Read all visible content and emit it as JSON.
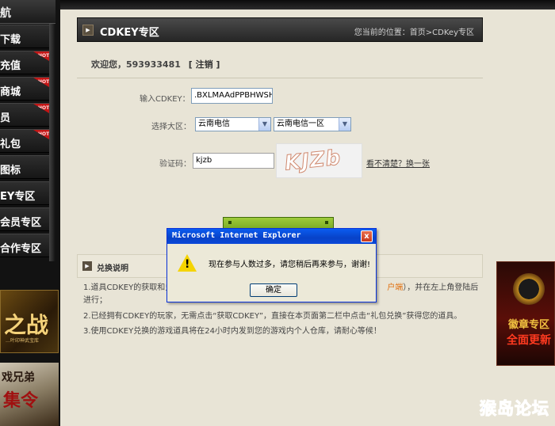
{
  "nav": {
    "header": "航",
    "items": [
      {
        "label": "下载",
        "hot": false
      },
      {
        "label": "充值",
        "hot": true
      },
      {
        "label": "商城",
        "hot": true
      },
      {
        "label": "员",
        "hot": true
      },
      {
        "label": "礼包",
        "hot": true
      },
      {
        "label": "图标",
        "hot": false
      },
      {
        "label": "EY专区",
        "hot": false
      },
      {
        "label": "会员专区",
        "hot": false
      },
      {
        "label": "合作专区",
        "hot": false
      }
    ],
    "hot_label": "HOT",
    "promo1": {
      "big": "之战",
      "small": "…叶印神武宝库"
    },
    "promo2": {
      "t1": "戏兄弟",
      "t2": "集令"
    }
  },
  "section": {
    "title": "CDKEY专区",
    "breadcrumb": "您当前的位置：首页>CDKey专区"
  },
  "welcome": {
    "text": "欢迎您，593933481",
    "logout": "[ 注销 ]"
  },
  "form": {
    "cdkey_label": "输入CDKEY：",
    "cdkey_value": ".BXLMAAdPPBHWSHG",
    "region_label": "选择大区：",
    "region_value": "云南电信",
    "server_value": "云南电信一区",
    "captcha_label": "验证码：",
    "captcha_value": "kjzb",
    "captcha_image_text": "KJZb",
    "refresh_link": "看不清楚？换一张"
  },
  "info": {
    "title": "兑换说明",
    "line1_a": "1.道具CDKEY的获取和兑",
    "line1_b": "户端",
    "line1_c": "），并在左上角登陆后",
    "line1_d": "进行；",
    "line2": "2.已经拥有CDKEY的玩家，无需点击“获取CDKEY”，直接在本页面第二栏中点击“礼包兑换”获得您的道具。",
    "line3": "3.使用CDKEY兑换的游戏道具将在24小时内发到您的游戏内个人仓库，请耐心等候！"
  },
  "right_promo": {
    "t1": "徽章专区",
    "t2": "全面更新"
  },
  "watermark": "猴岛论坛",
  "dialog": {
    "title": "Microsoft Internet Explorer",
    "message": "现在参与人数过多，请您稍后再来参与，谢谢!",
    "ok_label": "确定",
    "warning_glyph": "!",
    "close_glyph": "x"
  }
}
